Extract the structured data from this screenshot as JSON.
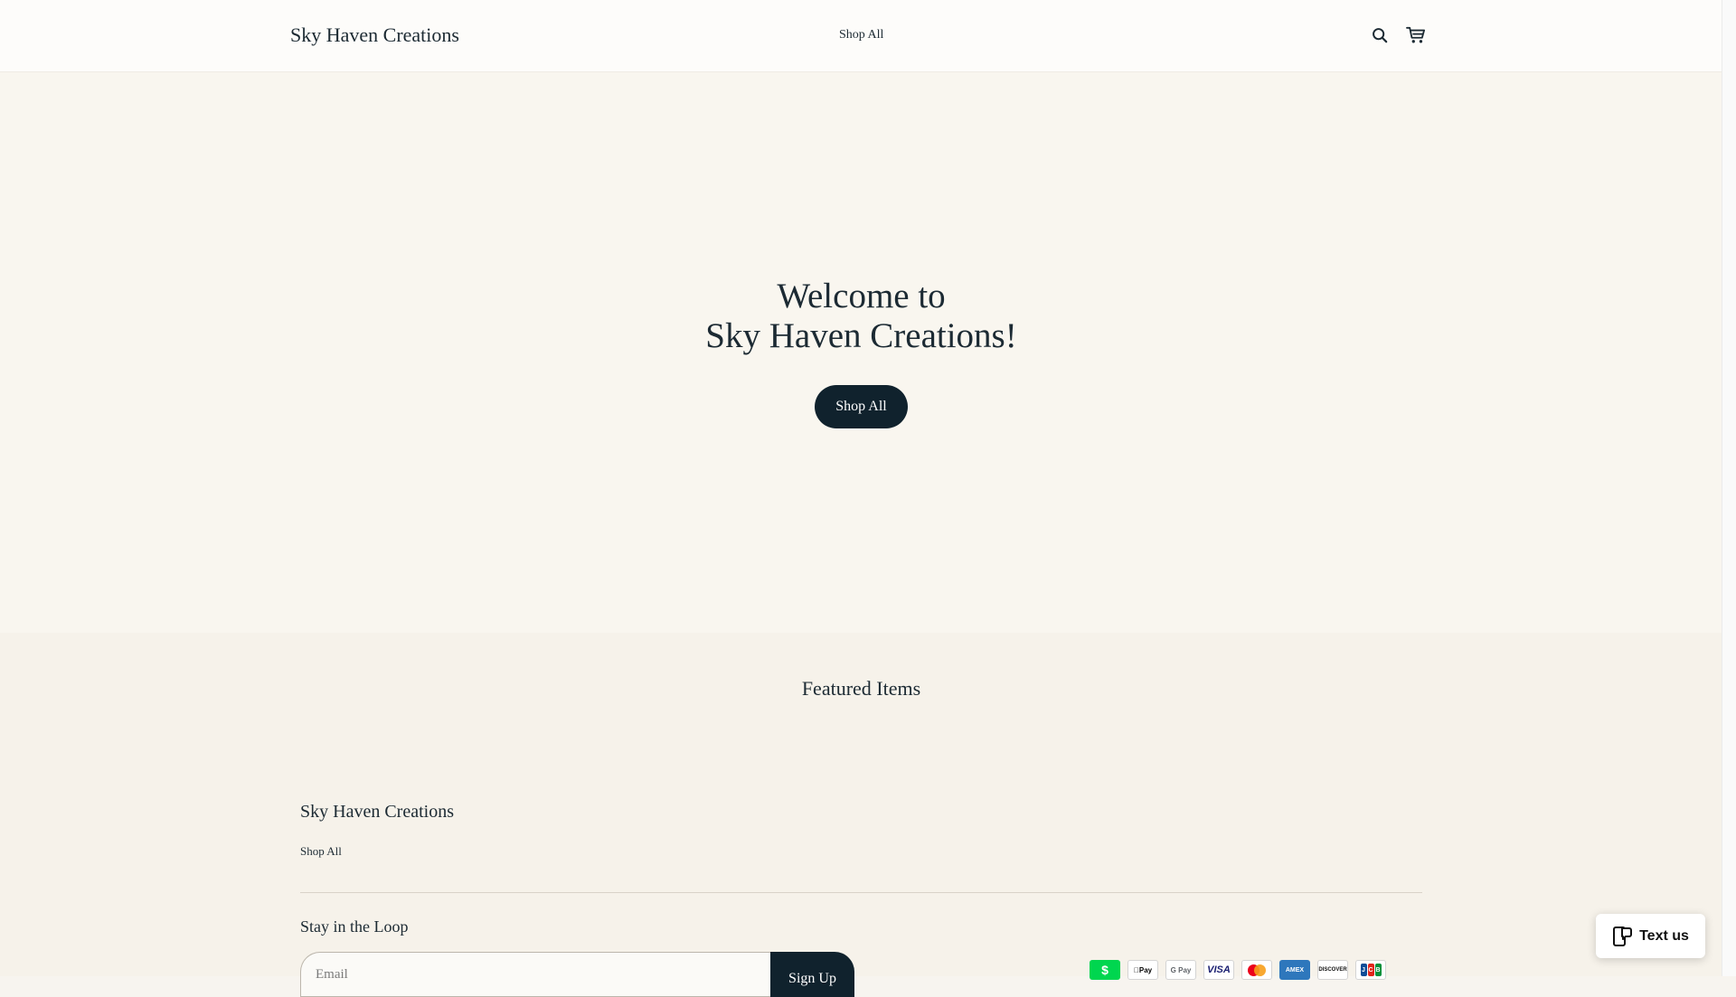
{
  "header": {
    "brand": "Sky Haven Creations",
    "nav": [
      {
        "label": "Shop All"
      }
    ],
    "icons": {
      "search": "search-icon",
      "cart": "cart-icon"
    }
  },
  "hero": {
    "title_line1": "Welcome to",
    "title_line2": "Sky Haven Creations!",
    "button_label": "Shop All"
  },
  "featured": {
    "title": "Featured Items"
  },
  "footer": {
    "brand": "Sky Haven Creations",
    "links": [
      {
        "label": "Shop All"
      }
    ],
    "newsletter": {
      "title": "Stay in the Loop",
      "email_placeholder": "Email",
      "button_label": "Sign Up"
    },
    "payment_methods": [
      "Cash App Pay",
      "Apple Pay",
      "Google Pay",
      "Visa",
      "Mastercard",
      "American Express",
      "Discover",
      "JCB"
    ],
    "payment_labels": {
      "apple": "Pay",
      "google": "G Pay",
      "visa": "VISA",
      "amex": "AMEX",
      "discover": "DISCOVER",
      "cashapp": "$"
    }
  },
  "chat_widget": {
    "label": "Text us"
  },
  "colors": {
    "primary_button": "#10222d",
    "hero_background": "#f9f6ef",
    "featured_background": "#f6f2ea",
    "text": "#1c2a33"
  }
}
